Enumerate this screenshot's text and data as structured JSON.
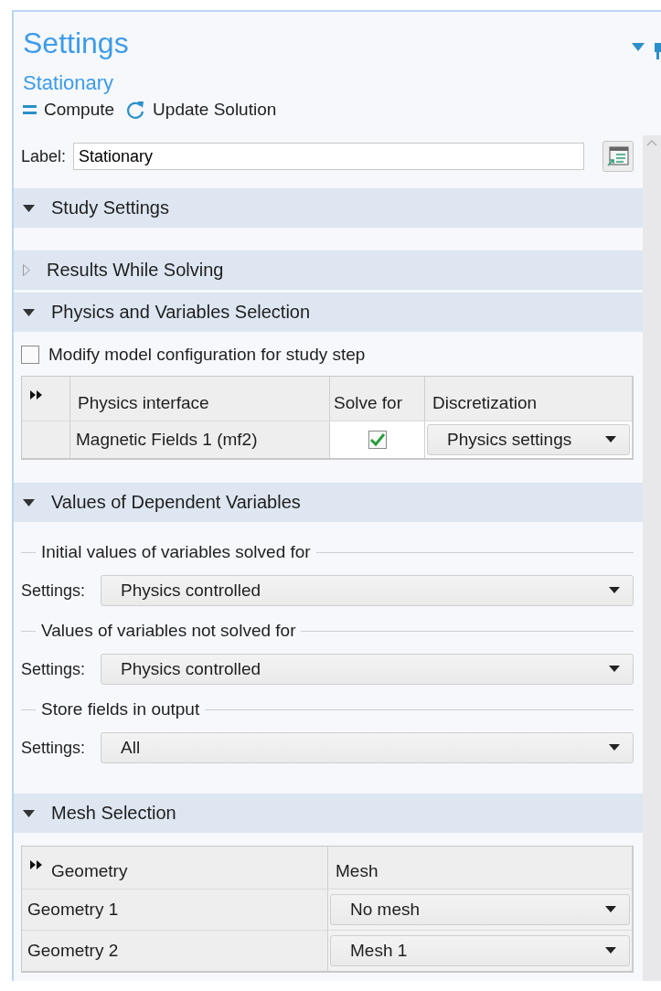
{
  "panel": {
    "title": "Settings",
    "subtitle": "Stationary",
    "toolbar": [
      {
        "kind": "compute",
        "label": "Compute"
      },
      {
        "kind": "update",
        "label": "Update Solution"
      }
    ]
  },
  "label_field": {
    "label": "Label:",
    "value": "Stationary"
  },
  "sections": [
    {
      "kind": "empty",
      "title": "Study Settings",
      "expanded": true
    },
    {
      "title": "Results While Solving",
      "expanded": false
    },
    {
      "kind": "physics",
      "title": "Physics and Variables Selection",
      "expanded": true,
      "checkbox": {
        "label": "Modify model configuration for study step",
        "checked": false
      },
      "table": {
        "columns": [
          "Physics interface",
          "Solve for",
          "Discretization"
        ],
        "rows": [
          {
            "name": "Magnetic Fields 1 (mf2)",
            "solve_for": true,
            "discretization": "Physics settings"
          }
        ]
      }
    },
    {
      "kind": "values",
      "title": "Values of Dependent Variables",
      "expanded": true,
      "groups": [
        {
          "title": "Initial values of variables solved for",
          "label": "Settings:",
          "value": "Physics controlled"
        },
        {
          "title": "Values of variables not solved for",
          "label": "Settings:",
          "value": "Physics controlled"
        },
        {
          "title": "Store fields in output",
          "label": "Settings:",
          "value": "All"
        }
      ]
    },
    {
      "kind": "mesh",
      "title": "Mesh Selection",
      "expanded": true,
      "table": {
        "columns": [
          "Geometry",
          "Mesh"
        ],
        "rows": [
          {
            "geometry": "Geometry 1",
            "mesh": "No mesh"
          },
          {
            "geometry": "Geometry 2",
            "mesh": "Mesh 1"
          }
        ]
      }
    }
  ]
}
